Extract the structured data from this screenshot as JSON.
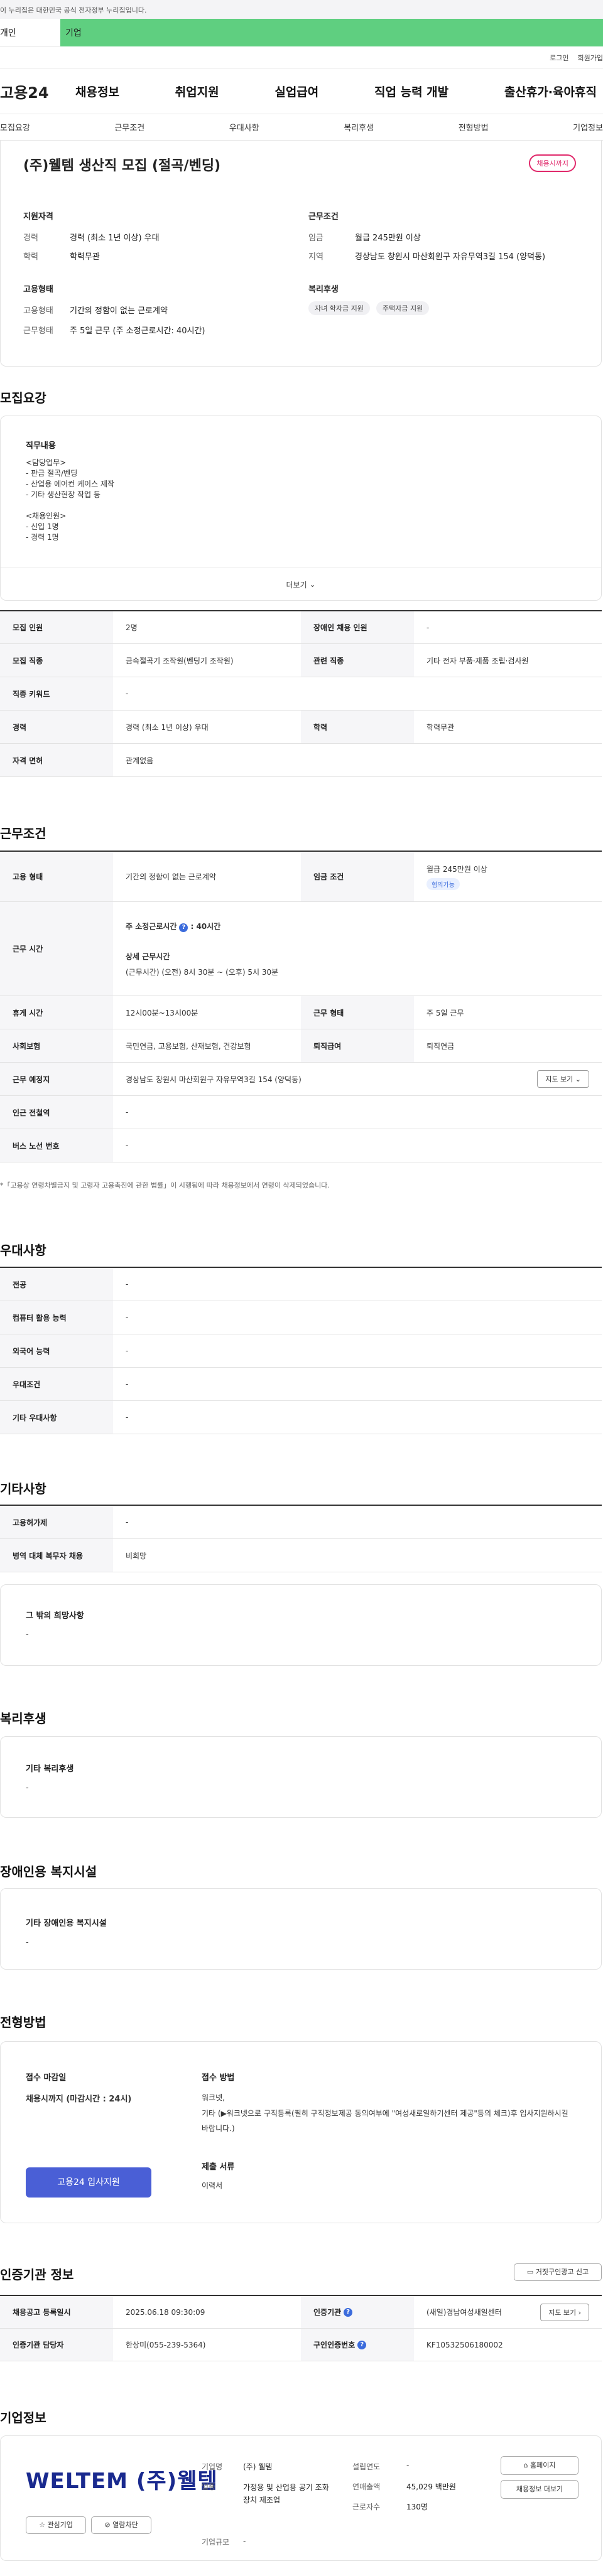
{
  "notice": "이 누리집은 대한민국 공식 전자정부 누리집입니다.",
  "top_tabs": [
    "개인",
    "기업"
  ],
  "utils": [
    "로그인",
    "회원가입"
  ],
  "logo": "고용24",
  "gnb": [
    "채용정보",
    "취업지원",
    "실업급여",
    "직업 능력 개발",
    "출산휴가·육아휴직"
  ],
  "anchors": [
    "모집요강",
    "근무조건",
    "우대사항",
    "복리후생",
    "전형방법",
    "기업정보"
  ],
  "header": {
    "title": "(주)웰템 생산직 모집 (절곡/벤딩)",
    "share": "채용시까지",
    "qual_label": "지원자격",
    "qual": [
      {
        "k": "경력",
        "v": "경력 (최소 1년 이상) 우대"
      },
      {
        "k": "학력",
        "v": "학력무관"
      }
    ],
    "cond_label": "근무조건",
    "cond": [
      {
        "k": "임금",
        "v": "월급 245만원 이상"
      },
      {
        "k": "지역",
        "v": "경상남도 창원시 마산회원구 자유무역3길 154 (양덕동)"
      }
    ],
    "emp_label": "고용형태",
    "emp": [
      {
        "k": "고용형태",
        "v": "기간의 정함이 없는 근로계약"
      },
      {
        "k": "근무형태",
        "v": "주 5일 근무 (주 소정근로시간: 40시간)"
      }
    ],
    "welfare_label": "복리후생",
    "welfare_chips": [
      "자녀 학자금 지원",
      "주택자금 지원"
    ]
  },
  "recruit": {
    "title": "모집요강",
    "duty_label": "직무내용",
    "duty_lines": [
      "<담당업무>",
      "- 판금 절곡/벤딩",
      "- 산업용 에어컨 케이스 제작",
      "- 기타 생산현장 작업 등",
      "",
      "<채용인원>",
      "- 신입 1명",
      "- 경력 1명"
    ],
    "more": "더보기",
    "rows": [
      {
        "k1": "모집 인원",
        "v1": "2명",
        "k2": "장애인 채용 인원",
        "v2": "-"
      },
      {
        "k1": "모집 직종",
        "v1": "금속절곡기 조작원(벤딩기 조작원)",
        "k2": "관련 직종",
        "v2": "기타 전자 부품·제품 조립·검사원"
      },
      {
        "k1": "직종 키워드",
        "v1": "-"
      },
      {
        "k1": "경력",
        "v1": "경력 (최소 1년 이상) 우대",
        "k2": "학력",
        "v2": "학력무관"
      },
      {
        "k1": "자격 면허",
        "v1": "관계없음"
      }
    ]
  },
  "work": {
    "title": "근무조건",
    "emp_k": "고용 형태",
    "emp_v": "기간의 정함이 없는 근로계약",
    "wage_k": "임금 조건",
    "wage_v": "월급 245만원 이상",
    "wage_badge": "협의가능",
    "hours_k": "근무 시간",
    "hours_weekly": "주 소정근로시간",
    "hours_weekly_v": ": 40시간",
    "hours_detail_label": "상세 근무시간",
    "hours_detail": "(근무시간) (오전) 8시 30분 ~ (오후) 5시 30분",
    "break_k": "휴게 시간",
    "break_v": "12시00분~13시00분",
    "form_k": "근무 형태",
    "form_v": "주 5일 근무",
    "ins_k": "사회보험",
    "ins_v": "국민연금, 고용보험, 산재보험, 건강보험",
    "sev_k": "퇴직급여",
    "sev_v": "퇴직연금",
    "place_k": "근무 예정지",
    "place_v": "경상남도 창원시 마산회원구 자유무역3길 154 (양덕동)",
    "map_btn": "지도 보기",
    "station_k": "인근 전철역",
    "station_v": "-",
    "bus_k": "버스 노선 번호",
    "bus_v": "-",
    "note": "*「고용상 연령차별금지 및 고령자 고용촉진에 관한 법률」이 시행됨에 따라 채용정보에서 연령이 삭제되었습니다."
  },
  "pref": {
    "title": "우대사항",
    "rows": [
      {
        "k": "전공",
        "v": "-"
      },
      {
        "k": "컴퓨터 활용 능력",
        "v": "-"
      },
      {
        "k": "외국어 능력",
        "v": "-"
      },
      {
        "k": "우대조건",
        "v": "-"
      },
      {
        "k": "기타 우대사항",
        "v": "-"
      }
    ]
  },
  "etc": {
    "title": "기타사항",
    "rows": [
      {
        "k": "고용허가제",
        "v": "-"
      },
      {
        "k": "병역 대체 복무자 채용",
        "v": "비희망"
      }
    ],
    "wish_label": "그 밖의 희망사항",
    "wish_v": "-"
  },
  "benefit": {
    "title": "복리후생",
    "label": "기타 복리후생",
    "v": "-"
  },
  "disabled": {
    "title": "장애인용 복지시설",
    "label": "기타 장애인용 복지시설",
    "v": "-"
  },
  "process": {
    "title": "전형방법",
    "deadline_label": "접수 마감일",
    "deadline_v": "채용시까지 (마감시간 : 24시)",
    "apply_btn": "고용24 입사지원",
    "method_label": "접수 방법",
    "method_v1": "워크넷,",
    "method_v2": "기타 (▶워크넷으로 구직등록(필히 구직정보제공 동의여부에 \"여성새로일하기센터 제공\"등의 체크)후 입사지원하시길 바랍니다.)",
    "docs_label": "제출 서류",
    "docs_v": "이력서"
  },
  "agency": {
    "title": "인증기관 정보",
    "report_btn": "거짓구인광고 신고",
    "rows": [
      {
        "k1": "채용공고 등록일시",
        "v1": "2025.06.18 09:30:09",
        "k2": "인증기관",
        "v2": "(새일)경남여성새일센터",
        "btn": "지도 보기"
      },
      {
        "k1": "인증기관 담당자",
        "v1": "한상미(055-239-5364)",
        "k2": "구인인증번호",
        "v2": "KF10532506180002"
      }
    ]
  },
  "company": {
    "title": "기업정보",
    "logo_text": "WELTEM (주)웰템",
    "fav_btn": "관심기업",
    "block_btn": "열람차단",
    "fields": [
      {
        "k": "기업명",
        "v": "(주) 웰템"
      },
      {
        "k": "설립연도",
        "v": "-"
      },
      {
        "k": "업종",
        "v": "가정용 및 산업용 공기 조화장치 제조업"
      },
      {
        "k": "연매출액",
        "v": "45,029 백만원"
      },
      {
        "k": "근로자수",
        "v": "130명"
      },
      {
        "k": "기업규모",
        "v": "-"
      }
    ],
    "home_btn": "홈페이지",
    "jobs_btn": "채용정보 더보기"
  }
}
